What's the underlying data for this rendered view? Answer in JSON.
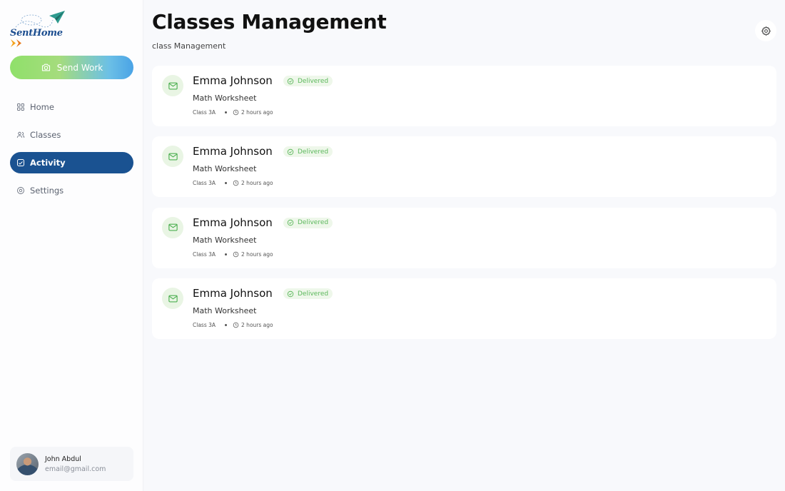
{
  "brand": {
    "sent": "Sent",
    "home": "Home"
  },
  "sidebar": {
    "send_button": "Send Work",
    "nav": [
      {
        "label": "Home",
        "icon": "grid-icon",
        "active": false
      },
      {
        "label": "Classes",
        "icon": "users-icon",
        "active": false
      },
      {
        "label": "Activity",
        "icon": "activity-icon",
        "active": true
      },
      {
        "label": "Settings",
        "icon": "settings-icon",
        "active": false
      }
    ],
    "user": {
      "name": "John Abdul",
      "email": "email@gmail.com"
    }
  },
  "header": {
    "title": "Classes Management",
    "subtitle": "class Management"
  },
  "activities": [
    {
      "name": "Emma Johnson",
      "status": "Delivered",
      "document": "Math Worksheet",
      "class": "Class 3A",
      "time": "2 hours ago"
    },
    {
      "name": "Emma Johnson",
      "status": "Delivered",
      "document": "Math Worksheet",
      "class": "Class 3A",
      "time": "2 hours ago"
    },
    {
      "name": "Emma Johnson",
      "status": "Delivered",
      "document": "Math Worksheet",
      "class": "Class 3A",
      "time": "2 hours ago"
    },
    {
      "name": "Emma Johnson",
      "status": "Delivered",
      "document": "Math Worksheet",
      "class": "Class 3A",
      "time": "2 hours ago"
    }
  ],
  "colors": {
    "primary": "#1a5291",
    "success": "#5cb85c",
    "success_bg": "#eef7ea",
    "mail_bg": "#e9f5e4"
  }
}
